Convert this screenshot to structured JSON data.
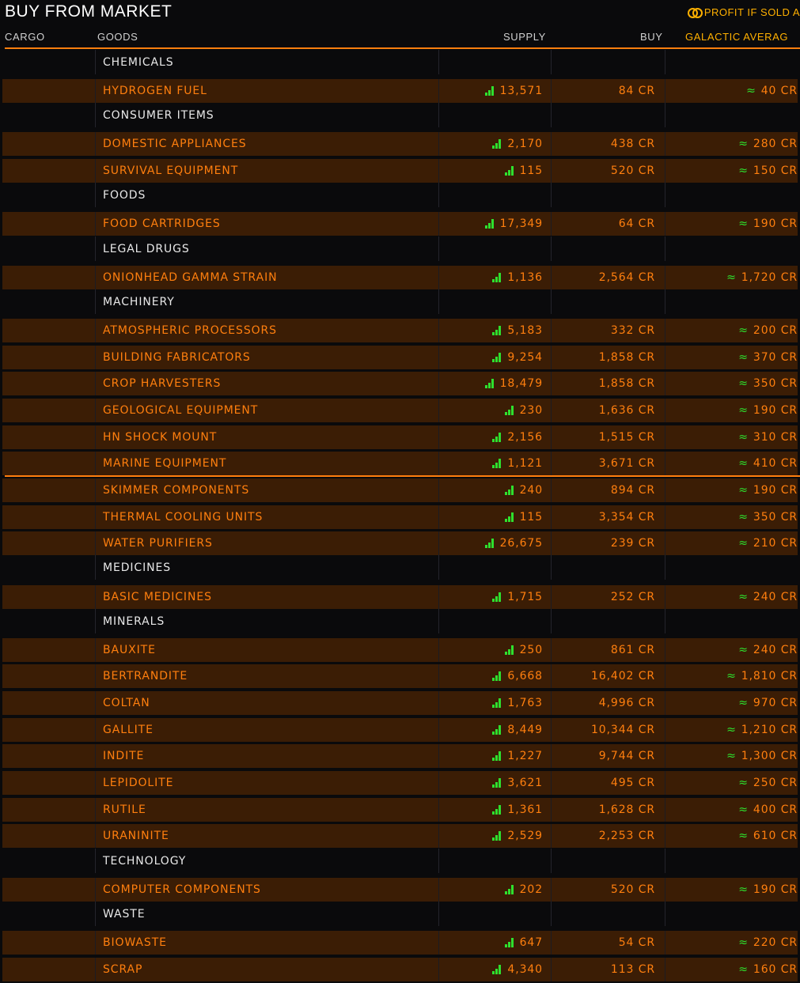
{
  "header": {
    "title": "BUY FROM MARKET",
    "profit_label": "PROFIT IF SOLD A"
  },
  "columns": {
    "cargo": "CARGO",
    "goods": "GOODS",
    "supply": "SUPPLY",
    "buy": "BUY",
    "galactic": "GALACTIC AVERAG"
  },
  "colors": {
    "accent": "#ff7f0e",
    "row_bg": "#3b1d05",
    "supply_indicator": "#2ee02e",
    "category_text": "#e8e8e8"
  },
  "rows": [
    {
      "type": "category",
      "name": "CHEMICALS"
    },
    {
      "type": "item",
      "name": "HYDROGEN FUEL",
      "supply": "13,571",
      "buy": "84 CR",
      "galactic": "40 CR",
      "approx": "≈"
    },
    {
      "type": "category",
      "name": "CONSUMER ITEMS"
    },
    {
      "type": "item",
      "name": "DOMESTIC APPLIANCES",
      "supply": "2,170",
      "buy": "438 CR",
      "galactic": "280 CR",
      "approx": "≈"
    },
    {
      "type": "item",
      "name": "SURVIVAL EQUIPMENT",
      "supply": "115",
      "buy": "520 CR",
      "galactic": "150 CR",
      "approx": "≈"
    },
    {
      "type": "category",
      "name": "FOODS"
    },
    {
      "type": "item",
      "name": "FOOD CARTRIDGES",
      "supply": "17,349",
      "buy": "64 CR",
      "galactic": "190 CR",
      "approx": "≈"
    },
    {
      "type": "category",
      "name": "LEGAL DRUGS"
    },
    {
      "type": "item",
      "name": "ONIONHEAD GAMMA STRAIN",
      "supply": "1,136",
      "buy": "2,564 CR",
      "galactic": "1,720 CR",
      "approx": "≈"
    },
    {
      "type": "category",
      "name": "MACHINERY"
    },
    {
      "type": "item",
      "name": "ATMOSPHERIC PROCESSORS",
      "supply": "5,183",
      "buy": "332 CR",
      "galactic": "200 CR",
      "approx": "≈"
    },
    {
      "type": "item",
      "name": "BUILDING FABRICATORS",
      "supply": "9,254",
      "buy": "1,858 CR",
      "galactic": "370 CR",
      "approx": "≈"
    },
    {
      "type": "item",
      "name": "CROP HARVESTERS",
      "supply": "18,479",
      "buy": "1,858 CR",
      "galactic": "350 CR",
      "approx": "≈"
    },
    {
      "type": "item",
      "name": "GEOLOGICAL EQUIPMENT",
      "supply": "230",
      "buy": "1,636 CR",
      "galactic": "190 CR",
      "approx": "≈"
    },
    {
      "type": "item",
      "name": "HN SHOCK MOUNT",
      "supply": "2,156",
      "buy": "1,515 CR",
      "galactic": "310 CR",
      "approx": "≈"
    },
    {
      "type": "item",
      "name": "MARINE EQUIPMENT",
      "supply": "1,121",
      "buy": "3,671 CR",
      "galactic": "410 CR",
      "approx": "≈"
    },
    {
      "type": "item",
      "name": "SKIMMER COMPONENTS",
      "supply": "240",
      "buy": "894 CR",
      "galactic": "190 CR",
      "approx": "≈"
    },
    {
      "type": "item",
      "name": "THERMAL COOLING UNITS",
      "supply": "115",
      "buy": "3,354 CR",
      "galactic": "350 CR",
      "approx": "≈"
    },
    {
      "type": "item",
      "name": "WATER PURIFIERS",
      "supply": "26,675",
      "buy": "239 CR",
      "galactic": "210 CR",
      "approx": "≈"
    },
    {
      "type": "category",
      "name": "MEDICINES"
    },
    {
      "type": "item",
      "name": "BASIC MEDICINES",
      "supply": "1,715",
      "buy": "252 CR",
      "galactic": "240 CR",
      "approx": "≈"
    },
    {
      "type": "category",
      "name": "MINERALS"
    },
    {
      "type": "item",
      "name": "BAUXITE",
      "supply": "250",
      "buy": "861 CR",
      "galactic": "240 CR",
      "approx": "≈"
    },
    {
      "type": "item",
      "name": "BERTRANDITE",
      "supply": "6,668",
      "buy": "16,402 CR",
      "galactic": "1,810 CR",
      "approx": "≈"
    },
    {
      "type": "item",
      "name": "COLTAN",
      "supply": "1,763",
      "buy": "4,996 CR",
      "galactic": "970 CR",
      "approx": "≈"
    },
    {
      "type": "item",
      "name": "GALLITE",
      "supply": "8,449",
      "buy": "10,344 CR",
      "galactic": "1,210 CR",
      "approx": "≈"
    },
    {
      "type": "item",
      "name": "INDITE",
      "supply": "1,227",
      "buy": "9,744 CR",
      "galactic": "1,300 CR",
      "approx": "≈"
    },
    {
      "type": "item",
      "name": "LEPIDOLITE",
      "supply": "3,621",
      "buy": "495 CR",
      "galactic": "250 CR",
      "approx": "≈"
    },
    {
      "type": "item",
      "name": "RUTILE",
      "supply": "1,361",
      "buy": "1,628 CR",
      "galactic": "400 CR",
      "approx": "≈"
    },
    {
      "type": "item",
      "name": "URANINITE",
      "supply": "2,529",
      "buy": "2,253 CR",
      "galactic": "610 CR",
      "approx": "≈"
    },
    {
      "type": "category",
      "name": "TECHNOLOGY"
    },
    {
      "type": "item",
      "name": "COMPUTER COMPONENTS",
      "supply": "202",
      "buy": "520 CR",
      "galactic": "190 CR",
      "approx": "≈"
    },
    {
      "type": "category",
      "name": "WASTE"
    },
    {
      "type": "item",
      "name": "BIOWASTE",
      "supply": "647",
      "buy": "54 CR",
      "galactic": "220 CR",
      "approx": "≈"
    },
    {
      "type": "item",
      "name": "SCRAP",
      "supply": "4,340",
      "buy": "113 CR",
      "galactic": "160 CR",
      "approx": "≈"
    }
  ]
}
